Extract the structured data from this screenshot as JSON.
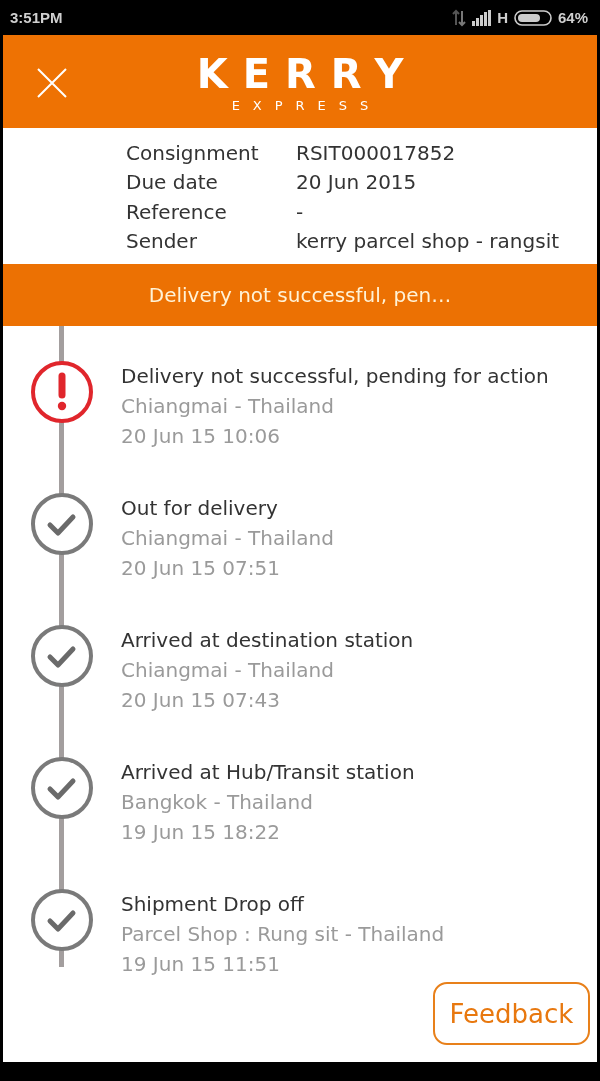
{
  "status_bar": {
    "time": "3:51PM",
    "network_type": "H",
    "battery_percent": "64%"
  },
  "header": {
    "logo_title": "KERRY",
    "logo_subtitle": "EXPRESS"
  },
  "details": [
    {
      "label": "Consignment",
      "value": "RSIT000017852"
    },
    {
      "label": "Due date",
      "value": "20 Jun 2015"
    },
    {
      "label": "Reference",
      "value": "-"
    },
    {
      "label": "Sender",
      "value": "kerry parcel shop - rangsit"
    }
  ],
  "status_banner": {
    "text": "Delivery not successful, pen…"
  },
  "timeline": [
    {
      "kind": "alert",
      "title": "Delivery not successful, pending for action",
      "location": "Chiangmai - Thailand",
      "time": "20 Jun 15 10:06"
    },
    {
      "kind": "check",
      "title": "Out for delivery",
      "location": "Chiangmai - Thailand",
      "time": "20 Jun 15 07:51"
    },
    {
      "kind": "check",
      "title": "Arrived at destination station",
      "location": "Chiangmai - Thailand",
      "time": "20 Jun 15 07:43"
    },
    {
      "kind": "check",
      "title": "Arrived at Hub/Transit station",
      "location": "Bangkok - Thailand",
      "time": "19 Jun 15 18:22"
    },
    {
      "kind": "check",
      "title": "Shipment Drop off",
      "location": "Parcel Shop : Rung sit - Thailand",
      "time": "19 Jun 15 11:51"
    }
  ],
  "feedback_button": {
    "label": "Feedback"
  }
}
